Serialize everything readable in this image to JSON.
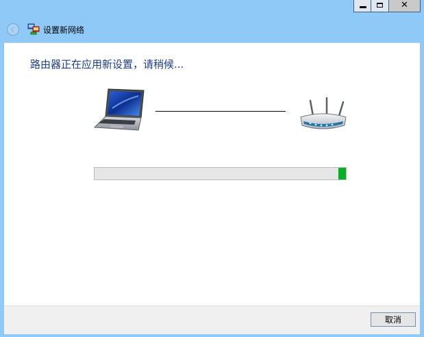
{
  "window": {
    "title": "设置新网络",
    "controls": {
      "minimize_icon": "minimize-icon",
      "maximize_icon": "maximize-icon",
      "close_icon": "close-icon",
      "close_glyph": "✕"
    }
  },
  "colors": {
    "frame": "#8ec9f7",
    "heading": "#1e3e8a",
    "progress_fill": "#06b025",
    "progress_track": "#e6e6e6",
    "footer": "#f0f0f0"
  },
  "main": {
    "heading": "路由器正在应用新设置，请稍候...",
    "laptop_icon": "laptop-icon",
    "router_icon": "router-icon",
    "progress": {
      "style": "marquee",
      "indicator_fraction": 0.03,
      "indicator_position": 0.97
    }
  },
  "footer": {
    "cancel_label": "取消"
  }
}
